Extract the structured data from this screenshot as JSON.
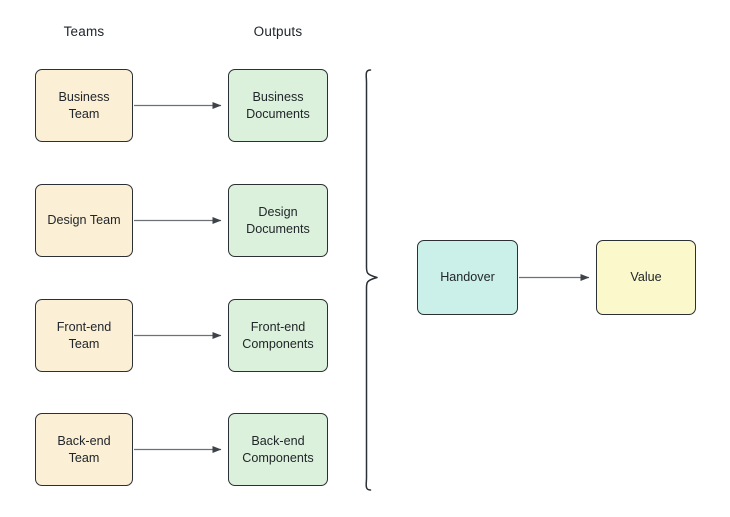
{
  "diagram": {
    "background_color": "#ffffff",
    "headers": {
      "teams": "Teams",
      "outputs": "Outputs"
    },
    "colors": {
      "team_fill": "#fbefd5",
      "output_fill": "#dcf1dc",
      "handover_fill": "#cbf0ea",
      "value_fill": "#fbf8cc",
      "stroke": "#2b3034",
      "connector": "#6b7177",
      "text": "#21262b"
    },
    "rows": [
      {
        "team": "Business\nTeam",
        "output": "Business\nDocuments"
      },
      {
        "team": "Design Team",
        "output": "Design\nDocuments"
      },
      {
        "team": "Front-end\nTeam",
        "output": "Front-end\nComponents"
      },
      {
        "team": "Back-end\nTeam",
        "output": "Back-end\nComponents"
      }
    ],
    "grouping": {
      "brace_label": "",
      "brace_orientation": "right-pointing",
      "spans_rows": 4
    },
    "handover": {
      "label": "Handover"
    },
    "value": {
      "label": "Value"
    },
    "connectors": [
      {
        "from": "Business Team",
        "to": "Business Documents",
        "style": "arrow"
      },
      {
        "from": "Design Team",
        "to": "Design Documents",
        "style": "arrow"
      },
      {
        "from": "Front-end Team",
        "to": "Front-end Components",
        "style": "arrow"
      },
      {
        "from": "Back-end Team",
        "to": "Back-end Components",
        "style": "arrow"
      },
      {
        "from": "Handover",
        "to": "Value",
        "style": "arrow"
      }
    ]
  }
}
